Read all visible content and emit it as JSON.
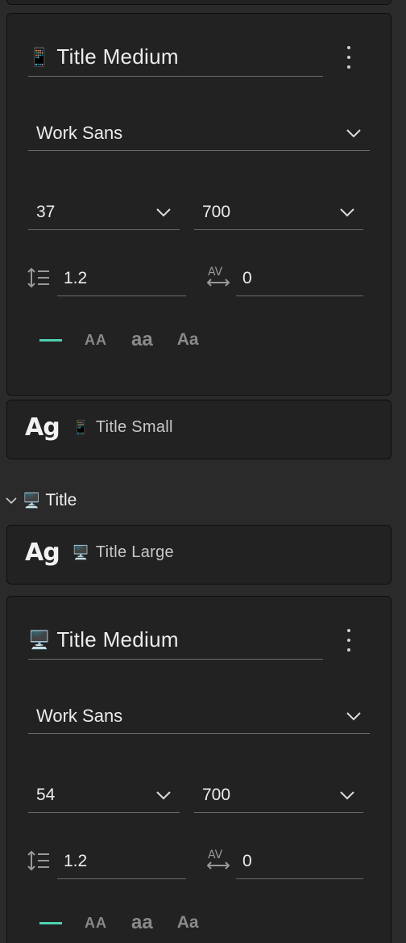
{
  "card_expanded_1": {
    "device_icon": "phone-icon",
    "name": "Title Medium",
    "font_family": "Work Sans",
    "font_size": "37",
    "font_weight": "700",
    "line_height": "1.2",
    "letter_spacing": "0",
    "case_options": [
      "AA",
      "aa",
      "Aa"
    ]
  },
  "card_collapsed_1": {
    "preview": "Ag",
    "device_icon": "phone-icon",
    "label": "Title Small"
  },
  "group": {
    "device_icon": "desktop-icon",
    "label": "Title"
  },
  "card_collapsed_2": {
    "preview": "Ag",
    "device_icon": "desktop-icon",
    "label": "Title Large"
  },
  "card_expanded_2": {
    "device_icon": "desktop-icon",
    "name": "Title Medium",
    "font_family": "Work Sans",
    "font_size": "54",
    "font_weight": "700",
    "line_height": "1.2",
    "letter_spacing": "0",
    "case_options": [
      "AA",
      "aa",
      "Aa"
    ]
  },
  "colors": {
    "accent": "#4fd1b0",
    "panel_bg": "#222222",
    "page_bg": "#2a2a2a"
  }
}
